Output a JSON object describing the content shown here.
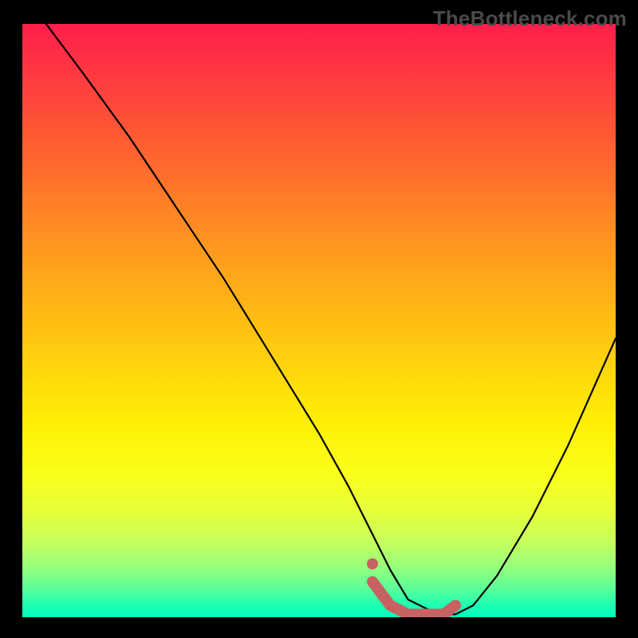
{
  "watermark": "TheBottleneck.com",
  "chart_data": {
    "type": "line",
    "title": "",
    "xlabel": "",
    "ylabel": "",
    "xlim": [
      0,
      100
    ],
    "ylim": [
      0,
      100
    ],
    "series": [
      {
        "name": "curve",
        "x": [
          4,
          10,
          18,
          26,
          34,
          42,
          50,
          55,
          59,
          62,
          65,
          70,
          73,
          76,
          80,
          86,
          92,
          100
        ],
        "y": [
          100,
          92,
          81,
          69,
          57,
          44,
          31,
          22,
          14,
          8,
          3,
          0.5,
          0.5,
          2,
          7,
          17,
          29,
          47
        ],
        "color": "#000000"
      },
      {
        "name": "marker-band",
        "x": [
          59,
          62,
          65,
          68,
          71,
          73
        ],
        "y": [
          6,
          2,
          0.5,
          0.5,
          0.5,
          2
        ],
        "color": "#c86161"
      }
    ],
    "gradient_stops": [
      {
        "pos": 0,
        "color": "#ff1e4a"
      },
      {
        "pos": 6,
        "color": "#ff3143"
      },
      {
        "pos": 14,
        "color": "#ff4a3a"
      },
      {
        "pos": 24,
        "color": "#ff6a2d"
      },
      {
        "pos": 35,
        "color": "#ff8f22"
      },
      {
        "pos": 46,
        "color": "#ffb117"
      },
      {
        "pos": 57,
        "color": "#ffd20d"
      },
      {
        "pos": 68,
        "color": "#fff106"
      },
      {
        "pos": 76,
        "color": "#faff1a"
      },
      {
        "pos": 82,
        "color": "#e7ff3a"
      },
      {
        "pos": 87,
        "color": "#c8ff5a"
      },
      {
        "pos": 91,
        "color": "#9dff78"
      },
      {
        "pos": 95,
        "color": "#5fff97"
      },
      {
        "pos": 98,
        "color": "#1cffb3"
      },
      {
        "pos": 100,
        "color": "#00ffc0"
      }
    ]
  }
}
